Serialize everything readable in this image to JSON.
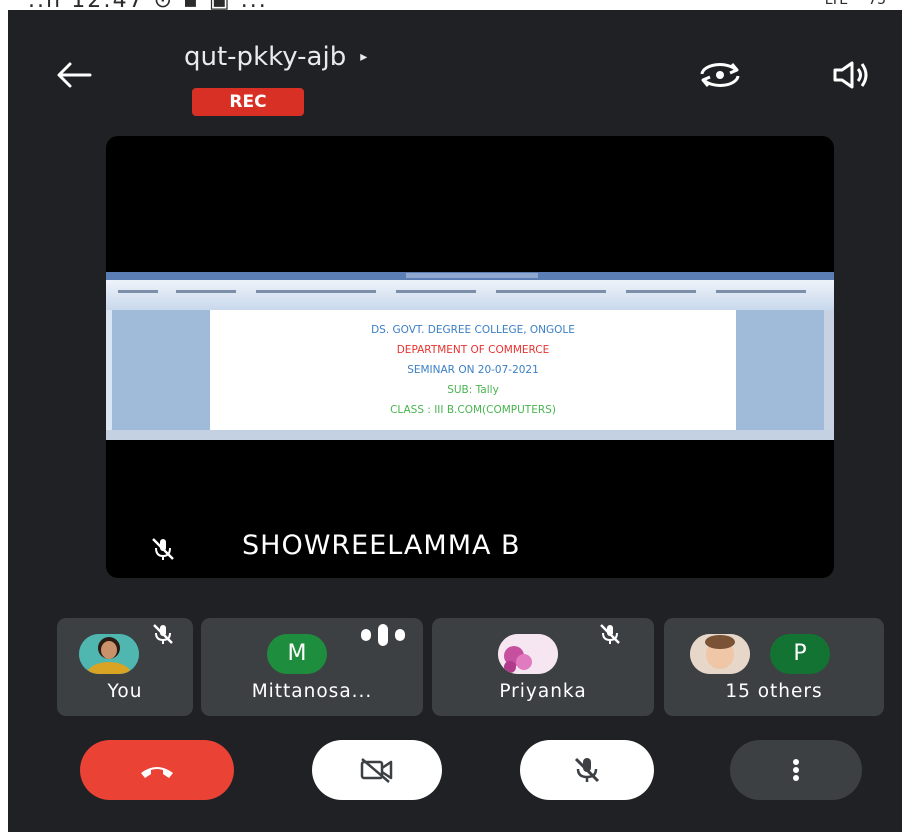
{
  "status_bar": {
    "left": "..ıl 12:47 ⊙ ▪ ▣ ...",
    "right": "LTE ⁴⁵ 75"
  },
  "header": {
    "meeting_code": "qut-pkky-ajb",
    "arrow": "▸",
    "recording_badge": "REC"
  },
  "presentation": {
    "lines": [
      "DS. GOVT. DEGREE COLLEGE, ONGOLE",
      "DEPARTMENT OF COMMERCE",
      "SEMINAR ON 20-07-2021",
      "SUB: Tally",
      "CLASS : III B.COM(COMPUTERS)"
    ],
    "presenter_name": "SHOWREELAMMA B"
  },
  "participants": [
    {
      "label": "You",
      "muted": true
    },
    {
      "label": "Mittanosa...",
      "initial": "M",
      "speaking": true
    },
    {
      "label": "Priyanka",
      "muted": true
    },
    {
      "label": "15 others",
      "initial": "P"
    }
  ],
  "colors": {
    "background": "#202124",
    "tile": "#3c4043",
    "end_call": "#ea4335",
    "recording": "#d93025",
    "avatar_m": "#1e8e3e",
    "avatar_p": "#137333",
    "doc_blue": "#3b7fc4",
    "doc_red": "#e8322f",
    "doc_green": "#49b44f"
  },
  "icons": [
    "back-arrow-icon",
    "rotate-camera-icon",
    "speaker-icon",
    "mic-off-icon",
    "audio-wave-icon",
    "end-call-icon",
    "camera-off-icon",
    "more-vert-icon"
  ]
}
